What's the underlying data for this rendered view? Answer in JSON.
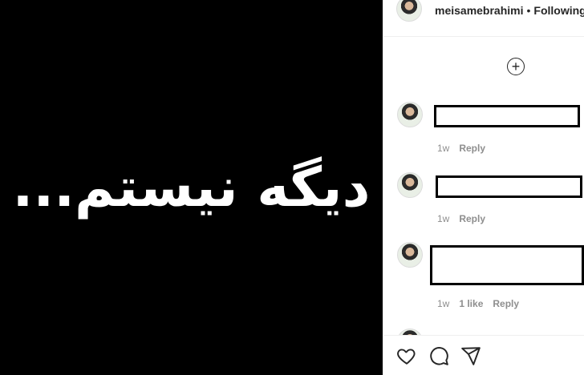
{
  "media": {
    "caption_text": "دیگه نیستم..."
  },
  "header": {
    "username": "meisamebrahimi",
    "separator": "•",
    "follow_status": "Following"
  },
  "load_more": {
    "icon": "plus-circle-icon"
  },
  "comments": [
    {
      "time": "1w",
      "reply_label": "Reply"
    },
    {
      "time": "1w",
      "reply_label": "Reply"
    },
    {
      "time": "1w",
      "likes": "1 like",
      "reply_label": "Reply"
    }
  ],
  "actions": [
    {
      "icon": "heart-icon"
    },
    {
      "icon": "comment-icon"
    },
    {
      "icon": "share-icon"
    }
  ]
}
